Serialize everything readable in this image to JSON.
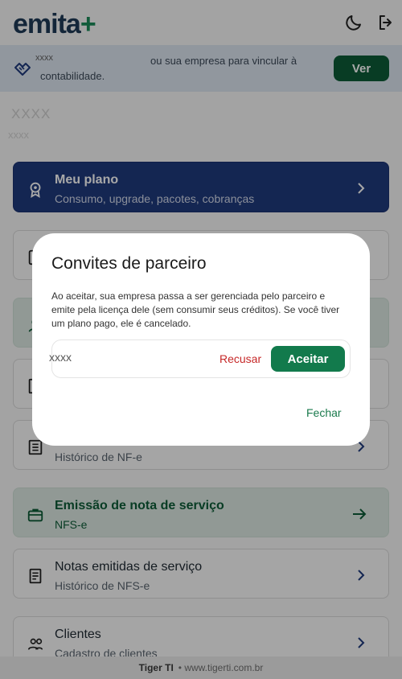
{
  "header": {
    "logo_text": "emita",
    "logo_plus": "+",
    "theme_icon": "moon-icon",
    "logout_icon": "logout-icon"
  },
  "banner": {
    "icon": "handshake-icon",
    "masked": "xxxx",
    "text_line1": "ou sua empresa para vincular à",
    "text_line2": "contabilidade.",
    "button_label": "Ver"
  },
  "user": {
    "masked_name": "XXXX",
    "masked_sub": "xxxx"
  },
  "cards": [
    {
      "title": "Meu plano",
      "subtitle": "Consumo, upgrade, pacotes, cobranças",
      "icon": "badge-icon"
    },
    {
      "title": "",
      "subtitle": "",
      "icon": "document-icon"
    },
    {
      "title": "",
      "subtitle": "",
      "icon": "person-icon"
    },
    {
      "title": "",
      "subtitle": "",
      "icon": "receipt-icon"
    },
    {
      "title": "",
      "subtitle": "Histórico de NF-e",
      "icon": "list-icon"
    },
    {
      "title": "Emissão de nota de serviço",
      "subtitle": "NFS-e",
      "icon": "briefcase-icon"
    },
    {
      "title": "Notas emitidas de serviço",
      "subtitle": "Histórico de NFS-e",
      "icon": "invoice-icon"
    },
    {
      "title": "Clientes",
      "subtitle": "Cadastro de clientes",
      "icon": "people-icon"
    }
  ],
  "footer": {
    "brand": "Tiger TI",
    "text": "• www.tigerti.com.br"
  },
  "dialog": {
    "title": "Convites de parceiro",
    "description": "Ao aceitar, sua empresa passa a ser gerenciada pelo parceiro e emite pela licença dele (sem consumir seus créditos). Se você tiver um plano pago, ele é cancelado.",
    "invite_name": "xxxx",
    "reject_label": "Recusar",
    "accept_label": "Aceitar",
    "close_label": "Fechar"
  },
  "colors": {
    "primary_green": "#0d5c37",
    "navy": "#1f3a7d",
    "danger": "#c62828"
  }
}
